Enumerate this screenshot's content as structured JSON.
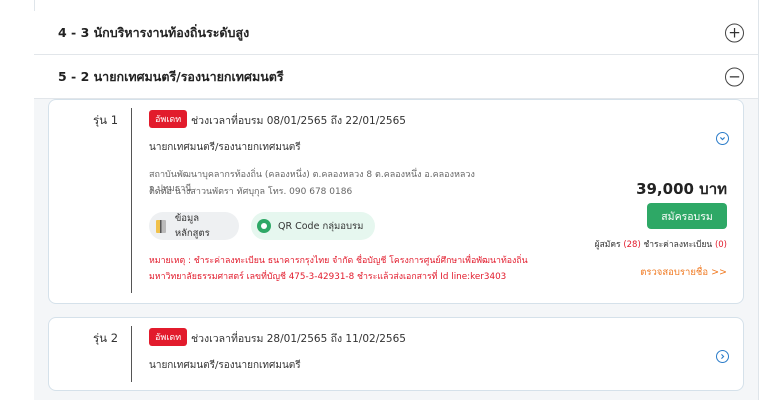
{
  "sections": [
    {
      "title": "4 - 3 นักบริหารงานท้องถิ่นระดับสูง",
      "toggle": "+"
    },
    {
      "title": "5 - 2 นายกเทศมนตรี/รองนายกเทศมนตรี",
      "toggle": "−"
    }
  ],
  "courses": [
    {
      "gen": "รุ่น 1",
      "badge": "อัพเดท",
      "period": "ช่วงเวลาที่อบรม 08/01/2565 ถึง 22/01/2565",
      "position": "นายกเทศมนตรี/รองนายกเทศมนตรี",
      "address_line1": "สถาบันพัฒนาบุคลากรท้องถิ่น (คลองหนึ่ง) ต.คลองหลวง 8 ต.คลองหนึ่ง อ.คลองหลวง จ.ปทุมธานี",
      "address_line2": "ติดต่อ นางสาวนพัตรา ทัศบุกุล โทร. 090 678 0186",
      "course_info_button": "ข้อมูลหลักสูตร",
      "qr_button": "QR Code กลุ่มอบรม",
      "note_line1": "หมายเหตุ : ชำระค่าลงทะเบียน ธนาคารกรุงไทย จำกัด ชื่อบัญชี โครงการศูนย์ศึกษาเพื่อพัฒนาท้องถิ่น",
      "note_line2": "มหาวิทยาลัยธรรมศาสตร์ เลขที่บัญชี 475-3-42931-8 ชำระแล้วส่งเอกสารที่ Id line:ker3403",
      "price": "39,000 บาท",
      "apply_button": "สมัครอบรม",
      "applicants_label": "ผู้สมัคร",
      "applicants_count": "(28)",
      "paid_label": "ชำระค่าลงทะเบียน",
      "paid_count": "(0)",
      "check_link": "ตรวจสอบรายชื่อ >>",
      "expand_icon": "chevron-down-icon"
    },
    {
      "gen": "รุ่น 2",
      "badge": "อัพเดท",
      "period": "ช่วงเวลาที่อบรม 28/01/2565 ถึง 11/02/2565",
      "position": "นายกเทศมนตรี/รองนายกเทศมนตรี",
      "expand_icon": "chevron-right-icon"
    }
  ],
  "colors": {
    "badge_red": "#e21b2c",
    "apply_green": "#2ea866",
    "link_orange": "#f07a22",
    "accent_blue": "#2b7cc9"
  }
}
